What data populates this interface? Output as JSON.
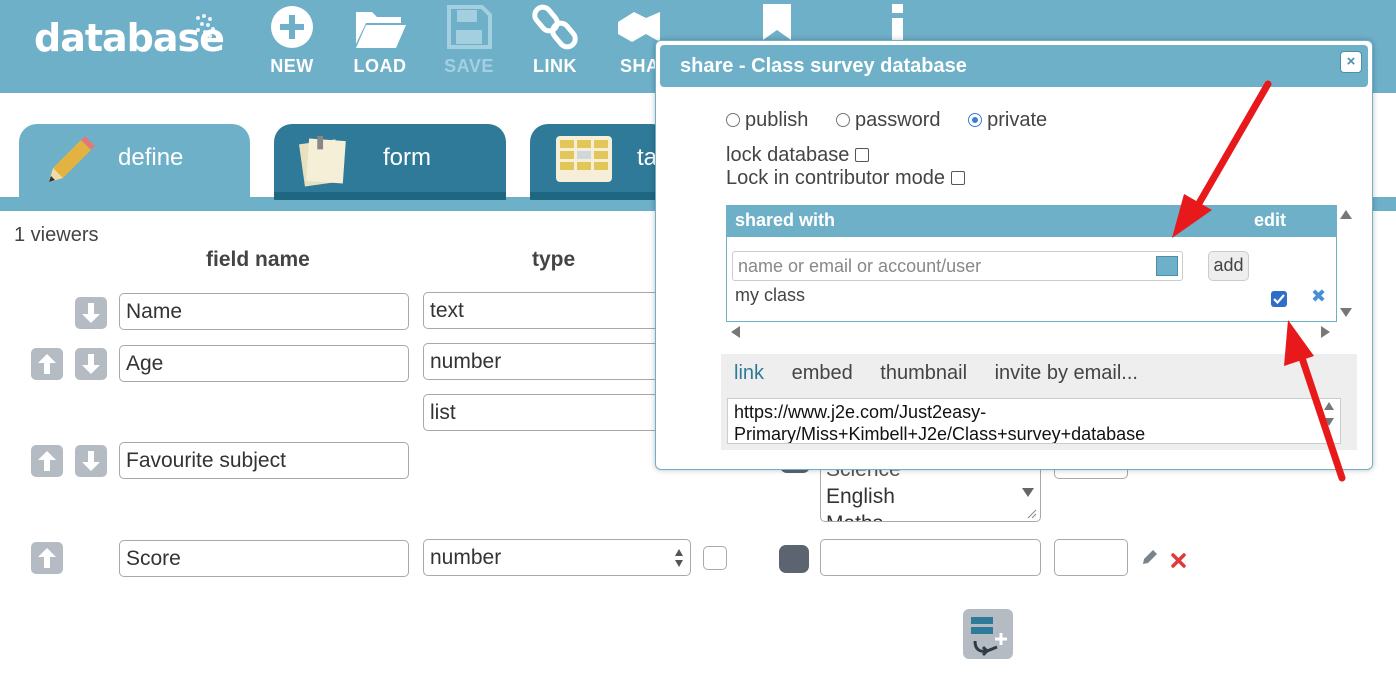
{
  "app": {
    "logo_text": "database"
  },
  "toolbar": {
    "new_label": "NEW",
    "load_label": "LOAD",
    "save_label": "SAVE",
    "link_label": "LINK",
    "share_label": "SHA"
  },
  "tabs": [
    {
      "label": "define",
      "active": true
    },
    {
      "label": "form",
      "active": false
    },
    {
      "label": "ta",
      "active": false
    }
  ],
  "viewers": "1 viewers",
  "columns": {
    "field_name": "field name",
    "type": "type"
  },
  "fields": [
    {
      "name": "Name",
      "type": "text"
    },
    {
      "name": "Age",
      "type": "number"
    },
    {
      "name": "",
      "type": "list"
    },
    {
      "name": "Favourite subject",
      "type": ""
    },
    {
      "name": "Score",
      "type": "number"
    }
  ],
  "list_options": [
    "Science",
    "English",
    "Maths"
  ],
  "dialog": {
    "title": "share - Class survey database",
    "close": "×",
    "visibility": [
      {
        "label": "publish",
        "selected": false
      },
      {
        "label": "password",
        "selected": false
      },
      {
        "label": "private",
        "selected": true
      }
    ],
    "lock_database": "lock database",
    "lock_contributor": "Lock in contributor mode",
    "shared_with_header": "shared with",
    "edit_header": "edit",
    "share_input_placeholder": "name or email or account/user",
    "add_button": "add",
    "shared_entries": [
      {
        "name": "my class",
        "edit": true
      }
    ],
    "remove_icon": "✖",
    "link_tabs": [
      "link",
      "embed",
      "thumbnail",
      "invite by email..."
    ],
    "url": "https://www.j2e.com/Just2easy-Primary/Miss+Kimbell+J2e/Class+survey+database"
  },
  "colors": {
    "brand": "#6fb0c9",
    "tab_dark": "#2f7a99",
    "annotation_arrow": "#e8191a"
  }
}
